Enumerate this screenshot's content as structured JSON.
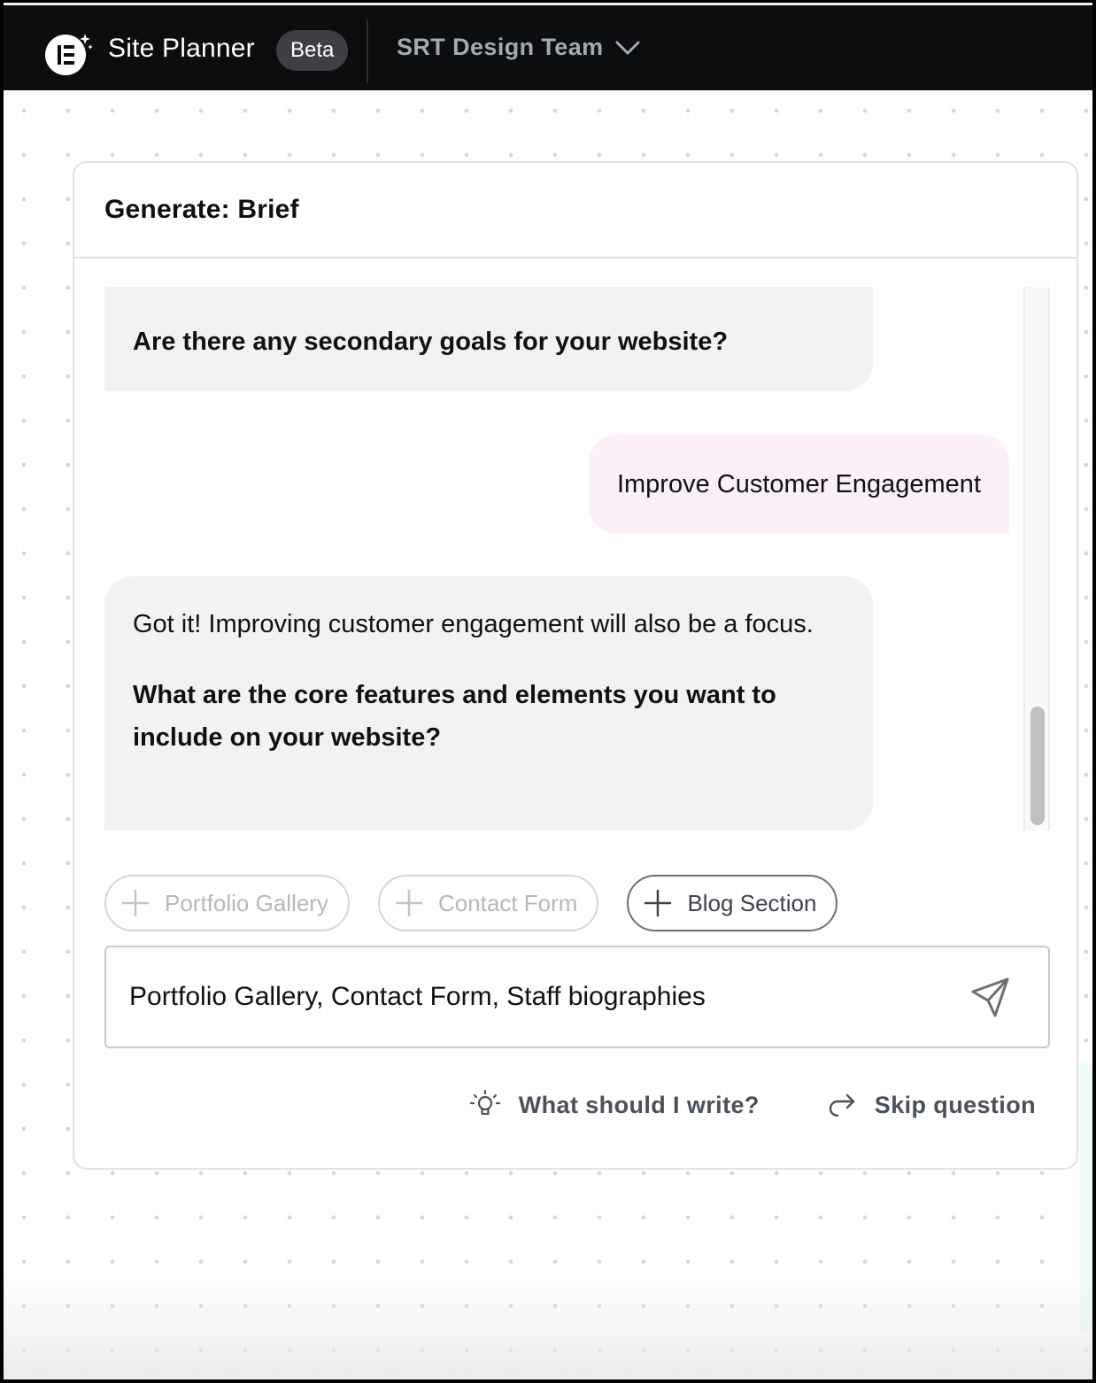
{
  "header": {
    "logo_icon": "elementor-ai-logo-icon",
    "app_title": "Site Planner",
    "badge": "Beta",
    "team_selector": {
      "value": "SRT Design Team",
      "icon": "chevron-down-icon"
    }
  },
  "card": {
    "title": "Generate: Brief"
  },
  "chat": {
    "messages": [
      {
        "role": "assistant",
        "text": "",
        "question": "Are there any secondary goals for your website?"
      },
      {
        "role": "user",
        "text": "Improve Customer Engagement"
      },
      {
        "role": "assistant",
        "text": "Got it! Improving customer engagement will also be a focus.",
        "question": "What are the core features and elements you want to include on your website?"
      }
    ]
  },
  "suggestions": [
    {
      "label": "Portfolio Gallery",
      "icon": "plus-icon",
      "state": "disabled"
    },
    {
      "label": "Contact Form",
      "icon": "plus-icon",
      "state": "disabled"
    },
    {
      "label": "Blog Section",
      "icon": "plus-icon",
      "state": "active"
    }
  ],
  "input": {
    "value": "Portfolio Gallery, Contact Form, Staff biographies",
    "send_icon": "send-icon"
  },
  "actions": {
    "hint_label": "What should I write?",
    "hint_icon": "lightbulb-icon",
    "skip_label": "Skip question",
    "skip_icon": "forward-arrow-icon"
  },
  "colors": {
    "header_bg": "#0c0d0f",
    "bot_bubble": "#f2f2f2",
    "user_bubble": "#fbf0f9",
    "muted_text": "#a3a9b3",
    "action_text": "#4b515a"
  }
}
